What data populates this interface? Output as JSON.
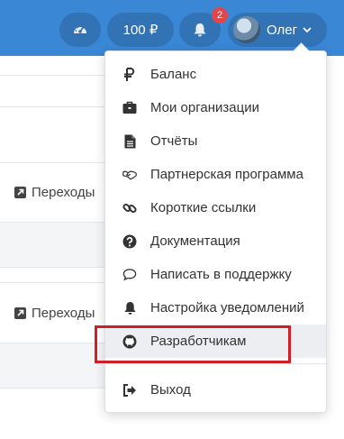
{
  "header": {
    "balance_label": "100 ₽",
    "notifications_count": "2",
    "user_name": "Олег"
  },
  "background": {
    "transitions_label_1": "Переходы",
    "transitions_label_2": "Переходы"
  },
  "menu": {
    "items": [
      {
        "label": "Баланс",
        "icon": "ruble-icon"
      },
      {
        "label": "Мои организации",
        "icon": "briefcase-icon"
      },
      {
        "label": "Отчёты",
        "icon": "document-icon"
      },
      {
        "label": "Партнерская программа",
        "icon": "handshake-icon"
      },
      {
        "label": "Короткие ссылки",
        "icon": "link-icon"
      },
      {
        "label": "Документация",
        "icon": "question-circle-icon"
      },
      {
        "label": "Написать в поддержку",
        "icon": "comment-icon"
      },
      {
        "label": "Настройка уведомлений",
        "icon": "bell-icon"
      },
      {
        "label": "Разработчикам",
        "icon": "github-icon"
      },
      {
        "label": "Выход",
        "icon": "sign-out-icon"
      }
    ],
    "highlighted_item": "Разработчикам"
  },
  "colors": {
    "header_bg": "#3a87d6",
    "pill_bg": "#3273b5",
    "badge_bg": "#e0474c",
    "highlight_box": "#d11f27"
  }
}
